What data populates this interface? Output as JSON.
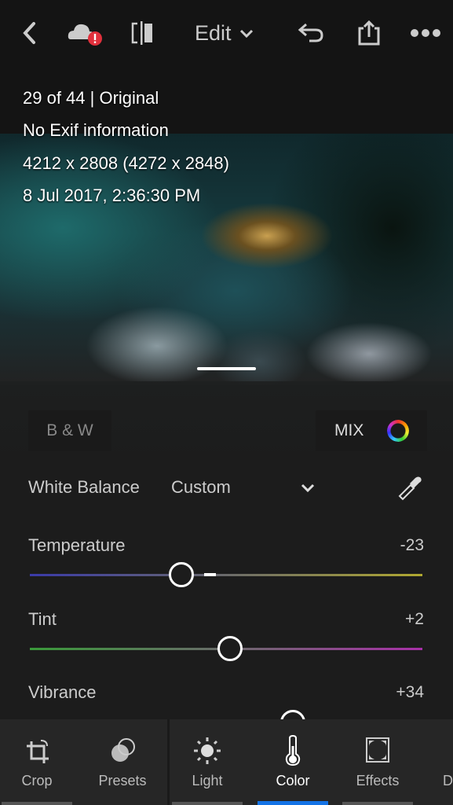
{
  "header": {
    "edit_label": "Edit",
    "icons": [
      "back-icon",
      "cloud-sync-error-icon",
      "compare-icon",
      "chevron-down-icon",
      "undo-icon",
      "share-icon",
      "more-icon"
    ]
  },
  "photo_info": [
    "29 of 44 | Original",
    "No Exif information",
    "4212 x 2808 (4272 x 2848)",
    "8 Jul 2017, 2:36:30 PM"
  ],
  "panel": {
    "bw_label": "B & W",
    "mix_label": "MIX",
    "white_balance": {
      "label": "White Balance",
      "value": "Custom"
    },
    "sliders": [
      {
        "label": "Temperature",
        "value": "-23",
        "level": -23,
        "range": [
          -100,
          100
        ]
      },
      {
        "label": "Tint",
        "value": "+2",
        "level": 2,
        "range": [
          -100,
          100
        ]
      },
      {
        "label": "Vibrance",
        "value": "+34",
        "level": 34,
        "range": [
          -100,
          100
        ]
      }
    ]
  },
  "tools": [
    {
      "label": "Crop",
      "icon": "crop-icon"
    },
    {
      "label": "Presets",
      "icon": "presets-icon"
    },
    {
      "label": "Light",
      "icon": "sun-icon"
    },
    {
      "label": "Color",
      "icon": "thermometer-icon",
      "active": true
    },
    {
      "label": "Effects",
      "icon": "effects-icon"
    },
    {
      "label": "D",
      "icon": ""
    }
  ],
  "colors": {
    "accent": "#1473e6",
    "error": "#e0303c"
  }
}
